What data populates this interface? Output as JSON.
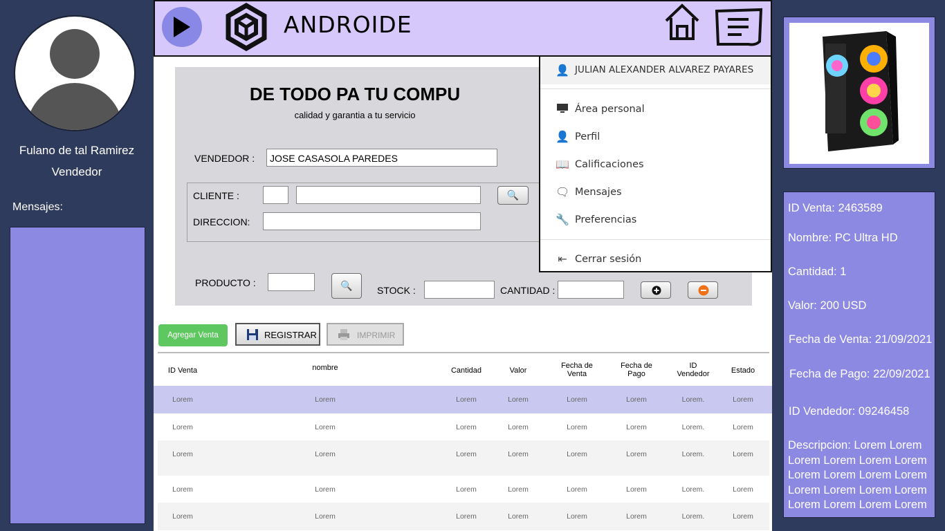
{
  "sidebar": {
    "user_name": "Fulano de tal Ramirez",
    "user_role": "Vendedor",
    "messages_label": "Mensajes:"
  },
  "header": {
    "brand_name": "ANDROIDE",
    "icons": [
      "play-icon",
      "brand-logo-icon",
      "home-icon",
      "menu-icon"
    ]
  },
  "form": {
    "title": "DE TODO PA TU COMPU",
    "subtitle": "calidad y garantia a tu servicio",
    "vendedor_label": "VENDEDOR :",
    "vendedor_value": "JOSE CASASOLA  PAREDES",
    "cliente_label": "CLIENTE :",
    "direccion_label": "DIRECCION:",
    "producto_label": "PRODUCTO :",
    "stock_label": "STOCK :",
    "cantidad_label": "CANTIDAD :"
  },
  "dropdown": {
    "user": "JULIAN ALEXANDER ALVAREZ PAYARES",
    "items": [
      {
        "icon": "monitor-icon",
        "label": "Área personal"
      },
      {
        "icon": "user-icon",
        "label": "Perfil"
      },
      {
        "icon": "book-icon",
        "label": "Calificaciones"
      },
      {
        "icon": "chat-icon",
        "label": "Mensajes"
      },
      {
        "icon": "wrench-icon",
        "label": "Preferencias"
      }
    ],
    "logout": "Cerrar sesión"
  },
  "details": {
    "id_venta": "ID Venta: 2463589",
    "nombre": "Nombre: PC Ultra HD",
    "cantidad": "Cantidad: 1",
    "valor": "Valor: 200 USD",
    "fecha_venta": "Fecha de Venta: 21/09/2021",
    "fecha_pago": "Fecha de Pago: 22/09/2021",
    "id_vendedor": "ID Vendedor: 09246458",
    "descripcion": "Descripcion: Lorem Lorem Lorem Lorem Lorem Lorem Lorem Lorem Lorem Lorem Lorem Lorem Lorem Lorem Lorem Lorem Lorem Lorem"
  },
  "actions": {
    "add": "Agregar Venta",
    "register": "REGISTRAR",
    "print": "IMPRIMIR"
  },
  "table": {
    "headers": [
      "ID Venta",
      "nombre",
      "Cantidad",
      "Valor",
      "Fecha de\nVenta",
      "Fecha de\nPago",
      "ID\nVendedor",
      "Estado"
    ],
    "rows": [
      [
        "Lorem",
        "Lorem",
        "Lorem",
        "Lorem",
        "Lorem",
        "Lorem",
        "Lorem.",
        "Lorem"
      ],
      [
        "Lorem",
        "Lorem",
        "Lorem",
        "Lorem",
        "Lorem",
        "Lorem",
        "Lorem.",
        "Lorem"
      ],
      [
        "Lorem",
        "Lorem",
        "Lorem",
        "Lorem",
        "Lorem",
        "Lorem",
        "Lorem.",
        "Lorem"
      ],
      [
        "Lorem",
        "Lorem",
        "Lorem",
        "Lorem",
        "Lorem",
        "Lorem",
        "Lorem.",
        "Lorem"
      ],
      [
        "Lorem",
        "Lorem",
        "Lorem",
        "Lorem",
        "Lorem",
        "Lorem",
        "Lorem.",
        "Lorem"
      ]
    ]
  },
  "colors": {
    "background": "#2f3b5c",
    "panel": "#8c89e2",
    "header": "#d7c8fb",
    "selected_row": "#c9c8f0",
    "add_button": "#5fc75f"
  }
}
